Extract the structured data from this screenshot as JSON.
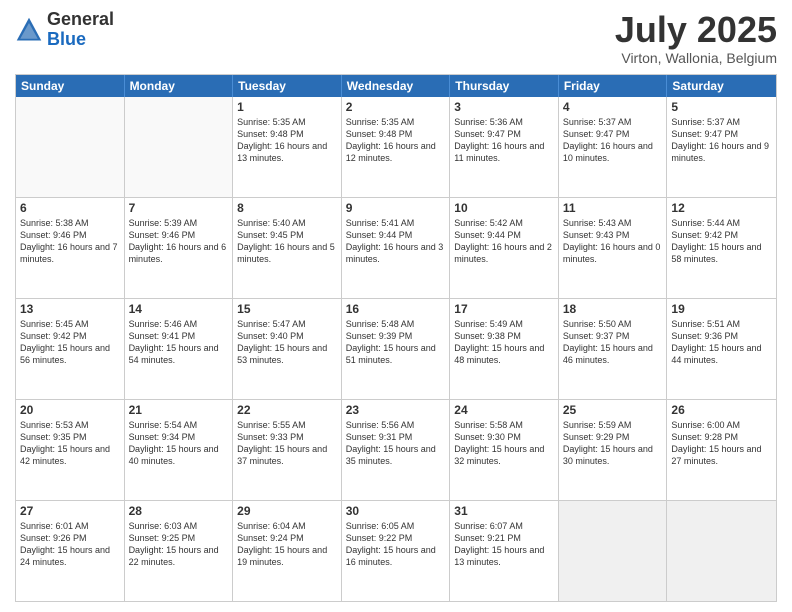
{
  "header": {
    "logo_line1": "General",
    "logo_line2": "Blue",
    "month": "July 2025",
    "location": "Virton, Wallonia, Belgium"
  },
  "days_of_week": [
    "Sunday",
    "Monday",
    "Tuesday",
    "Wednesday",
    "Thursday",
    "Friday",
    "Saturday"
  ],
  "rows": [
    [
      {
        "day": "",
        "info": ""
      },
      {
        "day": "",
        "info": ""
      },
      {
        "day": "1",
        "info": "Sunrise: 5:35 AM\nSunset: 9:48 PM\nDaylight: 16 hours and 13 minutes."
      },
      {
        "day": "2",
        "info": "Sunrise: 5:35 AM\nSunset: 9:48 PM\nDaylight: 16 hours and 12 minutes."
      },
      {
        "day": "3",
        "info": "Sunrise: 5:36 AM\nSunset: 9:47 PM\nDaylight: 16 hours and 11 minutes."
      },
      {
        "day": "4",
        "info": "Sunrise: 5:37 AM\nSunset: 9:47 PM\nDaylight: 16 hours and 10 minutes."
      },
      {
        "day": "5",
        "info": "Sunrise: 5:37 AM\nSunset: 9:47 PM\nDaylight: 16 hours and 9 minutes."
      }
    ],
    [
      {
        "day": "6",
        "info": "Sunrise: 5:38 AM\nSunset: 9:46 PM\nDaylight: 16 hours and 7 minutes."
      },
      {
        "day": "7",
        "info": "Sunrise: 5:39 AM\nSunset: 9:46 PM\nDaylight: 16 hours and 6 minutes."
      },
      {
        "day": "8",
        "info": "Sunrise: 5:40 AM\nSunset: 9:45 PM\nDaylight: 16 hours and 5 minutes."
      },
      {
        "day": "9",
        "info": "Sunrise: 5:41 AM\nSunset: 9:44 PM\nDaylight: 16 hours and 3 minutes."
      },
      {
        "day": "10",
        "info": "Sunrise: 5:42 AM\nSunset: 9:44 PM\nDaylight: 16 hours and 2 minutes."
      },
      {
        "day": "11",
        "info": "Sunrise: 5:43 AM\nSunset: 9:43 PM\nDaylight: 16 hours and 0 minutes."
      },
      {
        "day": "12",
        "info": "Sunrise: 5:44 AM\nSunset: 9:42 PM\nDaylight: 15 hours and 58 minutes."
      }
    ],
    [
      {
        "day": "13",
        "info": "Sunrise: 5:45 AM\nSunset: 9:42 PM\nDaylight: 15 hours and 56 minutes."
      },
      {
        "day": "14",
        "info": "Sunrise: 5:46 AM\nSunset: 9:41 PM\nDaylight: 15 hours and 54 minutes."
      },
      {
        "day": "15",
        "info": "Sunrise: 5:47 AM\nSunset: 9:40 PM\nDaylight: 15 hours and 53 minutes."
      },
      {
        "day": "16",
        "info": "Sunrise: 5:48 AM\nSunset: 9:39 PM\nDaylight: 15 hours and 51 minutes."
      },
      {
        "day": "17",
        "info": "Sunrise: 5:49 AM\nSunset: 9:38 PM\nDaylight: 15 hours and 48 minutes."
      },
      {
        "day": "18",
        "info": "Sunrise: 5:50 AM\nSunset: 9:37 PM\nDaylight: 15 hours and 46 minutes."
      },
      {
        "day": "19",
        "info": "Sunrise: 5:51 AM\nSunset: 9:36 PM\nDaylight: 15 hours and 44 minutes."
      }
    ],
    [
      {
        "day": "20",
        "info": "Sunrise: 5:53 AM\nSunset: 9:35 PM\nDaylight: 15 hours and 42 minutes."
      },
      {
        "day": "21",
        "info": "Sunrise: 5:54 AM\nSunset: 9:34 PM\nDaylight: 15 hours and 40 minutes."
      },
      {
        "day": "22",
        "info": "Sunrise: 5:55 AM\nSunset: 9:33 PM\nDaylight: 15 hours and 37 minutes."
      },
      {
        "day": "23",
        "info": "Sunrise: 5:56 AM\nSunset: 9:31 PM\nDaylight: 15 hours and 35 minutes."
      },
      {
        "day": "24",
        "info": "Sunrise: 5:58 AM\nSunset: 9:30 PM\nDaylight: 15 hours and 32 minutes."
      },
      {
        "day": "25",
        "info": "Sunrise: 5:59 AM\nSunset: 9:29 PM\nDaylight: 15 hours and 30 minutes."
      },
      {
        "day": "26",
        "info": "Sunrise: 6:00 AM\nSunset: 9:28 PM\nDaylight: 15 hours and 27 minutes."
      }
    ],
    [
      {
        "day": "27",
        "info": "Sunrise: 6:01 AM\nSunset: 9:26 PM\nDaylight: 15 hours and 24 minutes."
      },
      {
        "day": "28",
        "info": "Sunrise: 6:03 AM\nSunset: 9:25 PM\nDaylight: 15 hours and 22 minutes."
      },
      {
        "day": "29",
        "info": "Sunrise: 6:04 AM\nSunset: 9:24 PM\nDaylight: 15 hours and 19 minutes."
      },
      {
        "day": "30",
        "info": "Sunrise: 6:05 AM\nSunset: 9:22 PM\nDaylight: 15 hours and 16 minutes."
      },
      {
        "day": "31",
        "info": "Sunrise: 6:07 AM\nSunset: 9:21 PM\nDaylight: 15 hours and 13 minutes."
      },
      {
        "day": "",
        "info": ""
      },
      {
        "day": "",
        "info": ""
      }
    ]
  ]
}
